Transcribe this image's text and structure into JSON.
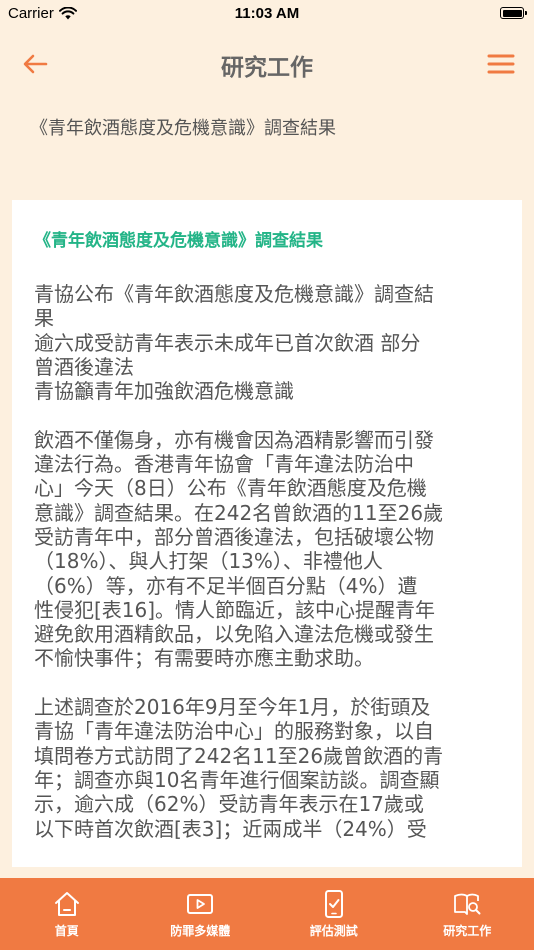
{
  "status_bar": {
    "carrier": "Carrier",
    "time": "11:03 AM"
  },
  "nav": {
    "title": "研究工作"
  },
  "page": {
    "subtitle": "《青年飲酒態度及危機意識》調查結果"
  },
  "article": {
    "title": "《青年飲酒態度及危機意識》調查結果",
    "paragraphs": [
      "青協公布《青年飲酒態度及危機意識》調查結\n果\n逾六成受訪青年表示未成年已首次飲酒 部分\n曾酒後違法\n青協籲青年加強飲酒危機意識",
      "飲酒不僅傷身，亦有機會因為酒精影響而引發\n違法行為。香港青年協會「青年違法防治中\n心」今天（8日）公布《青年飲酒態度及危機\n意識》調查結果。在242名曾飲酒的11至26歲\n受訪青年中，部分曾酒後違法，包括破壞公物\n（18%）、與人打架（13%）、非禮他人\n（6%）等，亦有不足半個百分點（4%）遭\n性侵犯[表16]。情人節臨近，該中心提醒青年\n避免飲用酒精飲品，以免陷入違法危機或發生\n不愉快事件；有需要時亦應主動求助。",
      "上述調查於2016年9月至今年1月，於街頭及\n青協「青年違法防治中心」的服務對象，以自\n填問卷方式訪問了242名11至26歲曾飲酒的青\n年；調查亦與10名青年進行個案訪談。調查顯\n示，逾六成（62%）受訪青年表示在17歲或\n以下時首次飲酒[表3]；近兩成半（24%）受"
    ]
  },
  "tabs": [
    {
      "label": "首頁",
      "icon": "home-icon"
    },
    {
      "label": "防罪多媒體",
      "icon": "video-play-icon"
    },
    {
      "label": "評估測試",
      "icon": "checklist-phone-icon"
    },
    {
      "label": "研究工作",
      "icon": "book-search-icon"
    }
  ],
  "colors": {
    "accent": "#f07a42",
    "background": "#fdf0df",
    "article_title": "#23b487",
    "text": "#555555"
  }
}
